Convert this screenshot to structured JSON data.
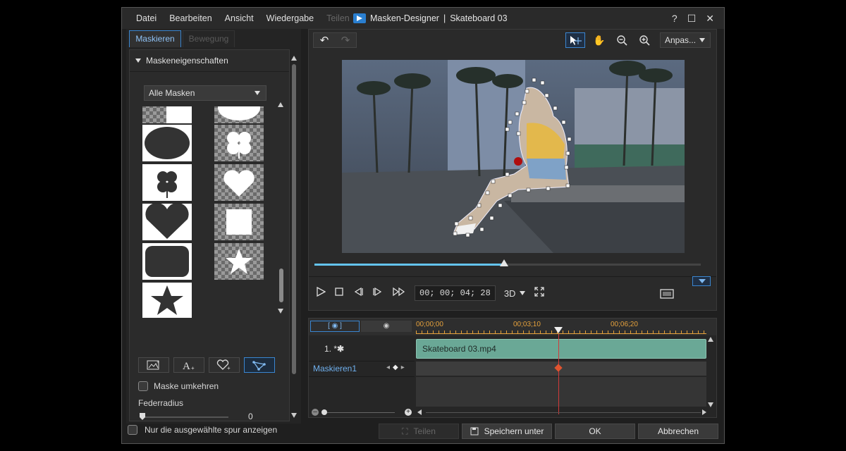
{
  "menu": [
    "Datei",
    "Bearbeiten",
    "Ansicht",
    "Wiedergabe",
    "Teilen"
  ],
  "window": {
    "title": "Masken-Designer",
    "separator": "|",
    "project": "Skateboard 03",
    "help": "?",
    "maximize": "☐",
    "close": "✕"
  },
  "left": {
    "tabs": [
      "Maskieren",
      "Bewegung"
    ],
    "section_title": "Maskeneigenschaften",
    "mask_filter": "Alle Masken",
    "shapes": [
      "rectangle",
      "circle",
      "ellipse",
      "clover",
      "flower",
      "heart",
      "heart",
      "square",
      "rounded-rect",
      "star",
      "star"
    ],
    "tool_icons": [
      "image-mask-icon",
      "text-mask-icon",
      "heart-plus-icon",
      "pen-mask-icon"
    ],
    "invert_label": "Maske umkehren",
    "feather_label": "Federradius",
    "feather_value": "0"
  },
  "preview": {
    "fit_label": "Anpas...",
    "timecode": "00; 00; 04; 28",
    "mode_3d": "3D",
    "progress": 0.49
  },
  "timeline": {
    "ruler": [
      "00;00;00",
      "00;03;10",
      "00;06;20"
    ],
    "track1_label": "1. *",
    "clip_name": "Skateboard 03.mp4",
    "mask_label": "Maskieren1",
    "playhead_position": 0.49
  },
  "footer": {
    "only_selected": "Nur die ausgewählte spur anzeigen",
    "split": "Teilen",
    "save_as": "Speichern unter",
    "ok": "OK",
    "cancel": "Abbrechen"
  },
  "colors": {
    "accent": "#3a86d1",
    "progress": "#64c4ef",
    "clip": "#6aa896",
    "playhead": "#d13a3a",
    "ruler": "#e6a23c"
  }
}
